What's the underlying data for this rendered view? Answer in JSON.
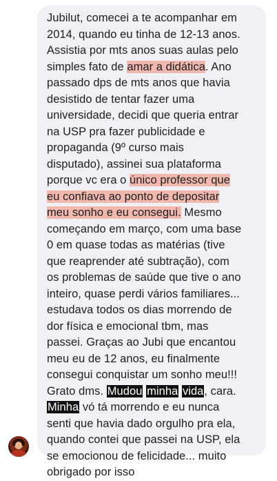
{
  "message": {
    "lines": [
      "Jubilut, comecei a te acompanhar em",
      "2014, quando eu tinha de 12-13 anos.",
      "Assistia por mts anos suas aulas pelo",
      {
        "before": "simples fato de ",
        "hl": "amar a didática",
        "after": ". Ano"
      },
      "passado dps de mts anos que havia",
      "desistido de tentar fazer uma",
      "universidade, decidi que queria entrar",
      "na USP pra fazer publicidade e",
      "propaganda (9º curso mais",
      "disputado), assinei sua plataforma",
      {
        "before": "porque vc era o ",
        "hl": "único professor que",
        "after": ""
      },
      {
        "before": "",
        "hl": "eu confiava ao ponto de depositar",
        "after": ""
      },
      {
        "before": "",
        "hl": "meu sonho e eu consegui.",
        "after": " Mesmo"
      },
      "começando em março, com uma base",
      "0 em quase todas as matérias (tive",
      "que reaprender até subtração), com",
      "os problemas de saúde que tive o ano",
      "inteiro, quase perdi vários familiares...",
      "estudava todos os dias morrendo de",
      "dor física e emocional tbm, mas",
      "passei. Graças ao Jubi que encantou",
      "meu eu de 12 anos, eu finalmente",
      "consegui conquistar um sonho meu!!!",
      {
        "before": "Grato dms. ",
        "dark": [
          "Mudou",
          "minha",
          "vida"
        ],
        "after": ", cara."
      },
      {
        "before": "",
        "dark": [
          "Minha"
        ],
        "after": " vó tá morrendo e eu nunca"
      },
      "senti que havia dado orgulho pra ela,",
      "quando contei que passei na USP, ela",
      "se emocionou de felicidade... muito",
      "obrigado por isso"
    ]
  },
  "colors": {
    "bubble": "#eff1f4",
    "highlight": "#f2b8ae",
    "dark_highlight": "#111111"
  },
  "avatar_icon": "user-avatar"
}
